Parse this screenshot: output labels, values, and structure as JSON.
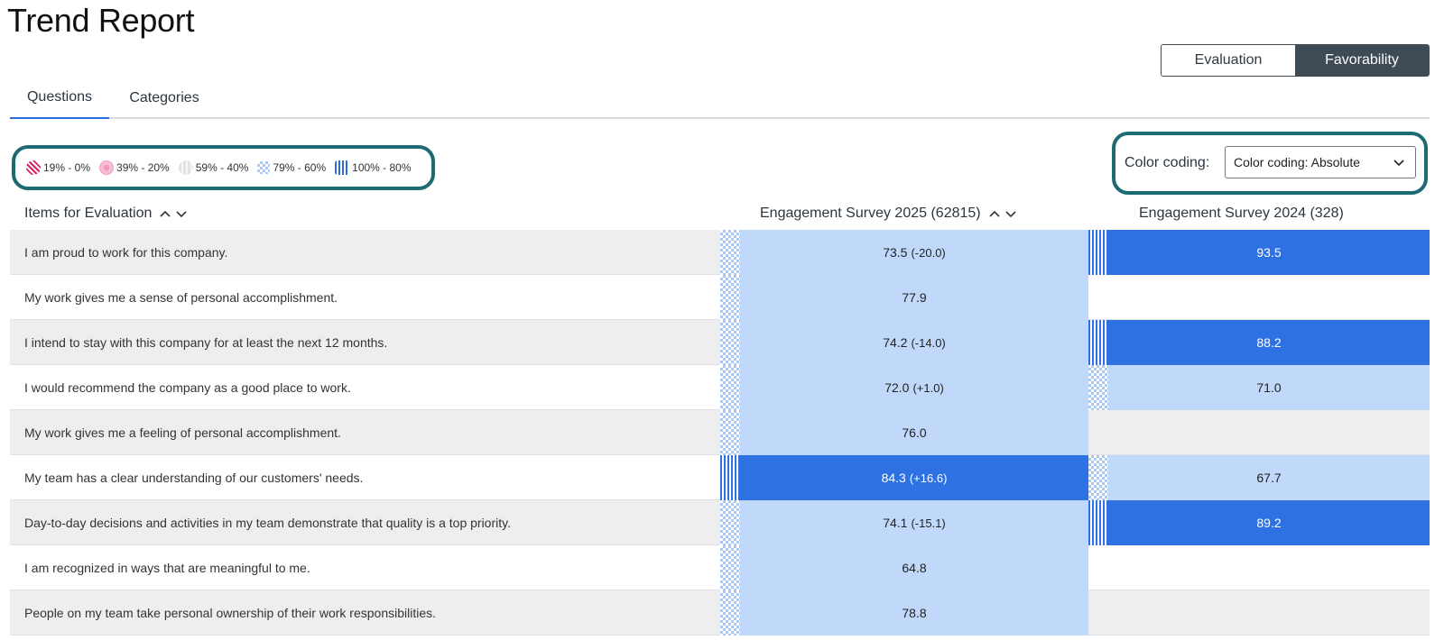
{
  "page": {
    "title": "Trend Report"
  },
  "view_toggle": {
    "options": [
      "Evaluation",
      "Favorability"
    ],
    "selected": "Favorability"
  },
  "tabs": [
    {
      "label": "Questions",
      "active": true
    },
    {
      "label": "Categories",
      "active": false
    }
  ],
  "legend": [
    {
      "label": "19% - 0%",
      "icon": "diagonal-stripes-red-icon"
    },
    {
      "label": "39% - 20%",
      "icon": "pink-flower-icon"
    },
    {
      "label": "59% - 40%",
      "icon": "gray-pattern-icon"
    },
    {
      "label": "79% - 60%",
      "icon": "blue-checker-icon"
    },
    {
      "label": "100% - 80%",
      "icon": "blue-vertical-stripes-icon"
    }
  ],
  "color_coding": {
    "label": "Color coding:",
    "selected": "Color coding: Absolute"
  },
  "columns": {
    "items": "Items for Evaluation",
    "survey_2025": "Engagement Survey 2025 (62815)",
    "survey_2024": "Engagement Survey 2024 (328)"
  },
  "rows": [
    {
      "question": "I am proud to work for this company.",
      "v2025": "73.5",
      "d2025": "(-20.0)",
      "b2025": "light",
      "v2024": "93.5",
      "b2024": "dark"
    },
    {
      "question": "My work gives me a sense of personal accomplishment.",
      "v2025": "77.9",
      "d2025": "",
      "b2025": "light",
      "v2024": "",
      "b2024": "none"
    },
    {
      "question": "I intend to stay with this company for at least the next 12 months.",
      "v2025": "74.2",
      "d2025": "(-14.0)",
      "b2025": "light",
      "v2024": "88.2",
      "b2024": "dark"
    },
    {
      "question": "I would recommend the company as a good place to work.",
      "v2025": "72.0",
      "d2025": "(+1.0)",
      "b2025": "light",
      "v2024": "71.0",
      "b2024": "light"
    },
    {
      "question": "My work gives me a feeling of personal accomplishment.",
      "v2025": "76.0",
      "d2025": "",
      "b2025": "light",
      "v2024": "",
      "b2024": "none"
    },
    {
      "question": "My team has a clear understanding of our customers' needs.",
      "v2025": "84.3",
      "d2025": "(+16.6)",
      "b2025": "dark",
      "v2024": "67.7",
      "b2024": "light"
    },
    {
      "question": "Day-to-day decisions and activities in my team demonstrate that quality is a top priority.",
      "v2025": "74.1",
      "d2025": "(-15.1)",
      "b2025": "light",
      "v2024": "89.2",
      "b2024": "dark"
    },
    {
      "question": "I am recognized in ways that are meaningful to me.",
      "v2025": "64.8",
      "d2025": "",
      "b2025": "light",
      "v2024": "",
      "b2024": "none"
    },
    {
      "question": "People on my team take personal ownership of their work responsibilities.",
      "v2025": "78.8",
      "d2025": "",
      "b2025": "light",
      "v2024": "",
      "b2024": "none"
    }
  ]
}
